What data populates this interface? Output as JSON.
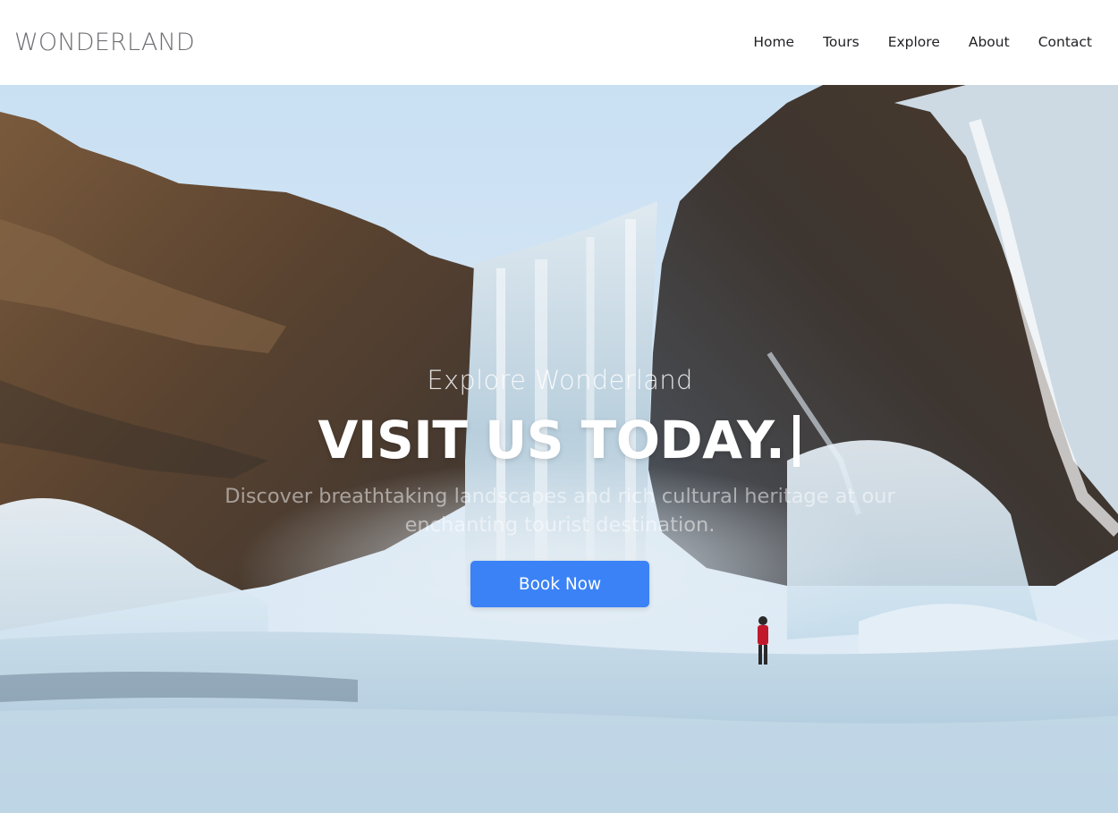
{
  "header": {
    "logo": "WONDERLAND",
    "nav": [
      {
        "label": "Home"
      },
      {
        "label": "Tours"
      },
      {
        "label": "Explore"
      },
      {
        "label": "About"
      },
      {
        "label": "Contact"
      }
    ]
  },
  "hero": {
    "background": "frozen-waterfall-photo",
    "eyebrow": "Explore Wonderland",
    "headline": "VISIT US TODAY.",
    "subtitle": "Discover breathtaking landscapes and rich cultural heritage at our enchanting tourist destination.",
    "cta_label": "Book Now"
  },
  "colors": {
    "accent": "#3b82f6",
    "logo_text": "#6f6f74",
    "nav_text": "#222226",
    "hero_text": "#ffffff"
  }
}
